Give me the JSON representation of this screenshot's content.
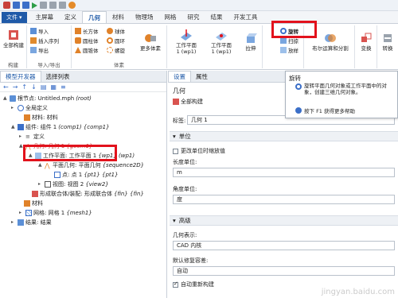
{
  "quick_access": {
    "icons": [
      "app-icon",
      "new-icon",
      "save-icon",
      "run-icon",
      "undo-icon",
      "redo-icon",
      "copy-icon",
      "settings-icon"
    ]
  },
  "menu": {
    "file_label": "文件",
    "tabs": [
      "主屏幕",
      "定义",
      "几何",
      "材料",
      "物理场",
      "网格",
      "研究",
      "结果",
      "开发工具"
    ],
    "active_tab": "几何"
  },
  "ribbon": {
    "build_all": "全部构建",
    "group_build": "构建",
    "import": "导入",
    "insert_sequence": "插入序列",
    "export": "导出",
    "group_import_export": "导入/导出",
    "cuboid": "长方体",
    "cylinder": "圆柱体",
    "cone": "圆锥体",
    "sphere": "球体",
    "torus": "圆环",
    "helix": "螺旋",
    "more_primitives": "更多体素",
    "group_primitives": "体素",
    "wp1_line1": "工作平面",
    "wp1_line2": "1 (wp1)",
    "wp2_line1": "工作平面",
    "wp2_line2": "1 (wp1)",
    "extrude": "拉伸",
    "revolve": "旋转",
    "sweep": "扫掠",
    "loft": "放样",
    "booleans": "布尔运算和分割",
    "transforms": "变换",
    "conversions": "转换"
  },
  "left_panel": {
    "tabs": [
      "模型开发器",
      "选择列表"
    ],
    "tree": [
      {
        "text": "根节点: Untitled.mph",
        "tag": "(root)"
      },
      {
        "text": "全局定义",
        "tag": ""
      },
      {
        "text": "材料: 材料",
        "tag": ""
      },
      {
        "text": "组件: 组件 1",
        "tag": "(comp1) {comp1}"
      },
      {
        "text": "定义",
        "tag": ""
      },
      {
        "text": "几何: 几何 1",
        "tag": "{geom1}"
      },
      {
        "text": "工作平面: 工作平面 1",
        "tag": "{wp1} (wp1)"
      },
      {
        "text": "平面几何: 平面几何",
        "tag": "{sequence2D}"
      },
      {
        "text": "点: 点 1",
        "tag": "{pt1} {pt1}"
      },
      {
        "text": "视图: 视图 2",
        "tag": "{view2}"
      },
      {
        "text": "形成联合体/装配: 形成联合体",
        "tag": "{fin} {fin}"
      },
      {
        "text": "材料",
        "tag": ""
      },
      {
        "text": "网格: 网格 1",
        "tag": "{mesh1}"
      },
      {
        "text": "结果: 结果",
        "tag": ""
      }
    ]
  },
  "right_panel": {
    "tabs": [
      "设置",
      "属性"
    ],
    "title": "几何",
    "build_all": "全部构建",
    "label_caption": "标签:",
    "label_value": "几何 1",
    "section_units": "单位",
    "scale_values": "更改单位时缩放值",
    "length_unit_label": "长度单位:",
    "length_unit_value": "m",
    "angle_unit_label": "角度单位:",
    "angle_unit_value": "度",
    "section_advanced": "高级",
    "geometry_repr_label": "几何表示:",
    "geometry_repr_value": "CAD 内核",
    "repair_tol_label": "默认修复容差:",
    "repair_tol_value": "自动",
    "auto_rebuild": "自动重新构建"
  },
  "tooltip": {
    "title": "旋转",
    "body": "旋转平面几何对象或工作平面中的对象，创建三维几何对象。",
    "help": "按下 F1 获得更多帮助"
  },
  "watermark": "jingyan.baidu.com"
}
